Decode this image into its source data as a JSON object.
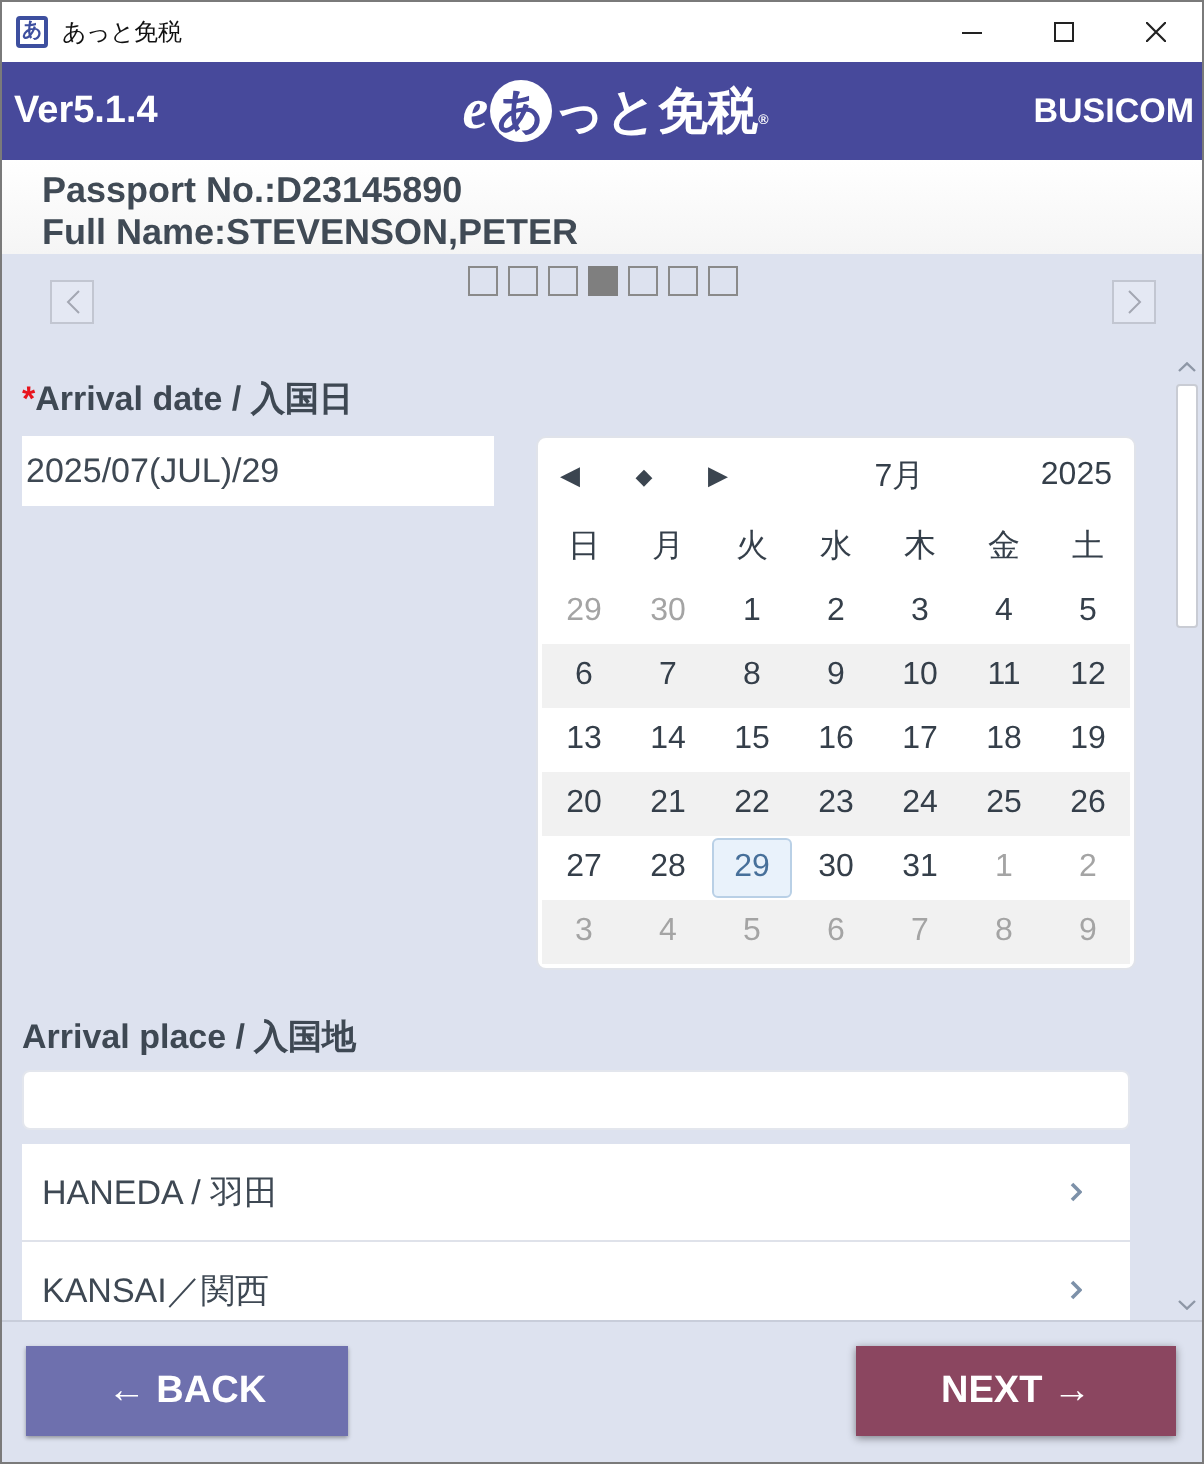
{
  "window": {
    "icon_glyph": "あ",
    "title": "あっと免税"
  },
  "header": {
    "version": "Ver5.1.4",
    "logo": {
      "prefix": "e",
      "badge": "あ",
      "text": "っと免税",
      "registered": "®"
    },
    "brand": "BUSICOM"
  },
  "passenger": {
    "passport": "Passport No.:D23145890",
    "full_name": "Full Name:STEVENSON,PETER"
  },
  "steps": [
    {
      "selected": false
    },
    {
      "selected": false
    },
    {
      "selected": false
    },
    {
      "selected": true
    },
    {
      "selected": false
    },
    {
      "selected": false
    },
    {
      "selected": false
    }
  ],
  "arrival_date": {
    "required_mark": "*",
    "label": "Arrival date / 入国日",
    "value": "2025/07(JUL)/29",
    "calendar": {
      "nav": [
        {
          "kind": "prev",
          "label": "◀"
        },
        {
          "kind": "today",
          "label": "◆"
        },
        {
          "kind": "next",
          "label": "▶"
        }
      ],
      "month": "7月",
      "year": "2025",
      "weekdays": [
        "日",
        "月",
        "火",
        "水",
        "木",
        "金",
        "土"
      ],
      "weeks": [
        [
          {
            "day": "29",
            "other_month": true,
            "selected": false
          },
          {
            "day": "30",
            "other_month": true,
            "selected": false
          },
          {
            "day": "1",
            "other_month": false,
            "selected": false
          },
          {
            "day": "2",
            "other_month": false,
            "selected": false
          },
          {
            "day": "3",
            "other_month": false,
            "selected": false
          },
          {
            "day": "4",
            "other_month": false,
            "selected": false
          },
          {
            "day": "5",
            "other_month": false,
            "selected": false
          }
        ],
        [
          {
            "day": "6",
            "other_month": false,
            "selected": false
          },
          {
            "day": "7",
            "other_month": false,
            "selected": false
          },
          {
            "day": "8",
            "other_month": false,
            "selected": false
          },
          {
            "day": "9",
            "other_month": false,
            "selected": false
          },
          {
            "day": "10",
            "other_month": false,
            "selected": false
          },
          {
            "day": "11",
            "other_month": false,
            "selected": false
          },
          {
            "day": "12",
            "other_month": false,
            "selected": false
          }
        ],
        [
          {
            "day": "13",
            "other_month": false,
            "selected": false
          },
          {
            "day": "14",
            "other_month": false,
            "selected": false
          },
          {
            "day": "15",
            "other_month": false,
            "selected": false
          },
          {
            "day": "16",
            "other_month": false,
            "selected": false
          },
          {
            "day": "17",
            "other_month": false,
            "selected": false
          },
          {
            "day": "18",
            "other_month": false,
            "selected": false
          },
          {
            "day": "19",
            "other_month": false,
            "selected": false
          }
        ],
        [
          {
            "day": "20",
            "other_month": false,
            "selected": false
          },
          {
            "day": "21",
            "other_month": false,
            "selected": false
          },
          {
            "day": "22",
            "other_month": false,
            "selected": false
          },
          {
            "day": "23",
            "other_month": false,
            "selected": false
          },
          {
            "day": "24",
            "other_month": false,
            "selected": false
          },
          {
            "day": "25",
            "other_month": false,
            "selected": false
          },
          {
            "day": "26",
            "other_month": false,
            "selected": false
          }
        ],
        [
          {
            "day": "27",
            "other_month": false,
            "selected": false
          },
          {
            "day": "28",
            "other_month": false,
            "selected": false
          },
          {
            "day": "29",
            "other_month": false,
            "selected": true
          },
          {
            "day": "30",
            "other_month": false,
            "selected": false
          },
          {
            "day": "31",
            "other_month": false,
            "selected": false
          },
          {
            "day": "1",
            "other_month": true,
            "selected": false
          },
          {
            "day": "2",
            "other_month": true,
            "selected": false
          }
        ],
        [
          {
            "day": "3",
            "other_month": true,
            "selected": false
          },
          {
            "day": "4",
            "other_month": true,
            "selected": false
          },
          {
            "day": "5",
            "other_month": true,
            "selected": false
          },
          {
            "day": "6",
            "other_month": true,
            "selected": false
          },
          {
            "day": "7",
            "other_month": true,
            "selected": false
          },
          {
            "day": "8",
            "other_month": true,
            "selected": false
          },
          {
            "day": "9",
            "other_month": true,
            "selected": false
          }
        ]
      ]
    }
  },
  "arrival_place": {
    "label": "Arrival place / 入国地",
    "options": [
      {
        "label": "HANEDA / 羽田"
      },
      {
        "label": "KANSAI／関西"
      }
    ]
  },
  "buttons": [
    {
      "kind": "back",
      "label": "← BACK"
    },
    {
      "kind": "next",
      "label": "NEXT →"
    }
  ]
}
